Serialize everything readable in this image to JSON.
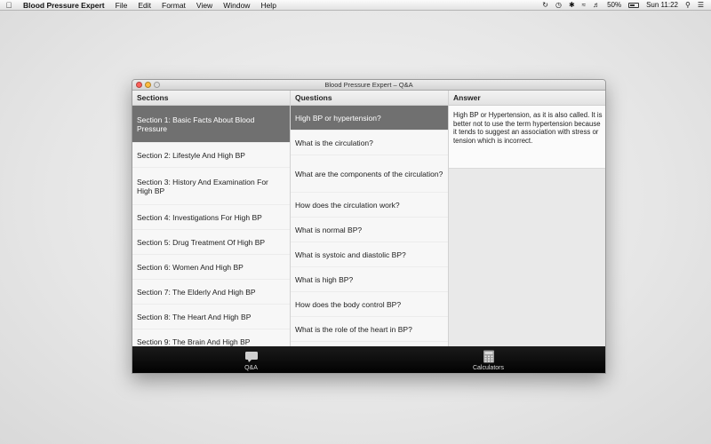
{
  "menubar": {
    "app_name": "Blood Pressure Expert",
    "items": [
      "File",
      "Edit",
      "Format",
      "View",
      "Window",
      "Help"
    ],
    "battery": "50%",
    "clock": "Sun 11:22"
  },
  "window": {
    "title": "Blood Pressure Expert – Q&A"
  },
  "columns": {
    "sections_header": "Sections",
    "questions_header": "Questions",
    "answer_header": "Answer"
  },
  "sections": [
    "Section 1: Basic Facts About Blood Pressure",
    "Section 2: Lifestyle And High BP",
    "Section 3: History And Examination For High BP",
    "Section 4: Investigations For High BP",
    "Section 5: Drug Treatment Of High BP",
    "Section 6: Women And High BP",
    "Section 7: The Elderly And High BP",
    "Section 8: The Heart And High BP",
    "Section 9: The Brain And High BP"
  ],
  "questions": [
    "High BP or hypertension?",
    "What is the circulation?",
    "What are the components of the circulation?",
    "How does the circulation work?",
    "What is normal BP?",
    "What is systoic and diastolic BP?",
    "What is high BP?",
    "How does the body control BP?",
    "What is the role of the heart in BP?"
  ],
  "answer_text": "High BP or Hypertension, as it is also called. It is better not to use the term hypertension because it tends to suggest an association with stress or tension which is incorrect.",
  "tabs": {
    "qa_label": "Q&A",
    "calculators_label": "Calculators"
  }
}
